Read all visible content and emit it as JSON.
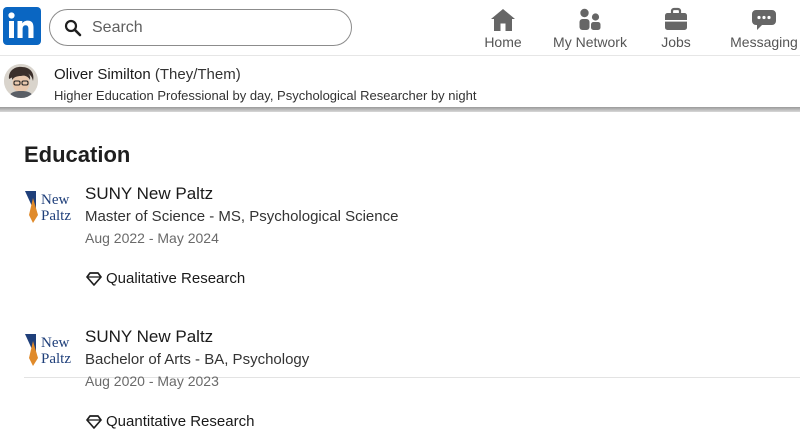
{
  "header": {
    "brand_color": "#0a66c2",
    "logo_icon": "linkedin-logo-icon",
    "search": {
      "placeholder": "Search",
      "value": ""
    },
    "nav": [
      {
        "label": "Home",
        "icon": "home-icon"
      },
      {
        "label": "My Network",
        "icon": "network-icon"
      },
      {
        "label": "Jobs",
        "icon": "briefcase-icon"
      },
      {
        "label": "Messaging",
        "icon": "messaging-icon"
      }
    ]
  },
  "profile": {
    "name": "Oliver Similton",
    "pronouns": "(They/Them)",
    "headline": "Higher Education Professional by day, Psychological Researcher by night"
  },
  "education": {
    "title": "Education",
    "items": [
      {
        "logo_text": [
          "New",
          "Paltz"
        ],
        "school": "SUNY New Paltz",
        "degree": "Master of Science - MS, Psychological Science",
        "dates": "Aug 2022 - May 2024",
        "skill": "Qualitative Research",
        "skill_icon": "diamond-icon"
      },
      {
        "logo_text": [
          "New",
          "Paltz"
        ],
        "school": "SUNY New Paltz",
        "degree": "Bachelor of Arts - BA, Psychology",
        "dates": "Aug 2020 - May 2023",
        "skill": "Quantitative Research",
        "skill_icon": "diamond-icon"
      }
    ]
  }
}
